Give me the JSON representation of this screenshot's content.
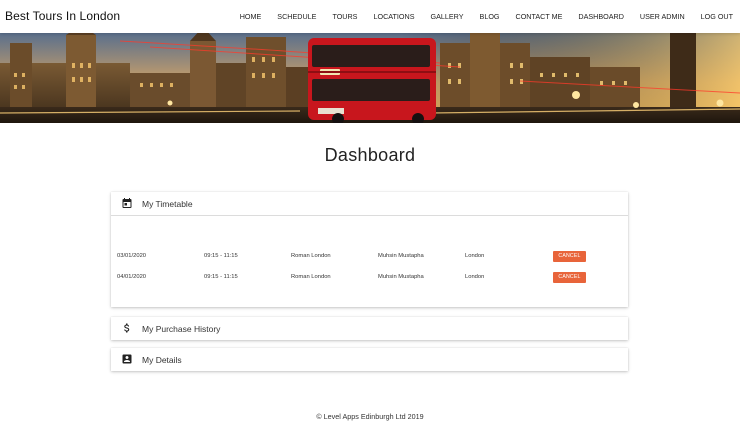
{
  "navbar": {
    "brand": "Best Tours In London",
    "links": [
      "HOME",
      "SCHEDULE",
      "TOURS",
      "LOCATIONS",
      "GALLERY",
      "BLOG",
      "CONTACT ME",
      "DASHBOARD",
      "USER ADMIN",
      "LOG OUT"
    ]
  },
  "page": {
    "title": "Dashboard"
  },
  "timetable": {
    "title": "My Timetable",
    "icon": "calendar-icon",
    "rows": [
      {
        "date": "03/01/2020",
        "time": "09:15 - 11:15",
        "tour": "Roman London",
        "guide": "Muhsin Mustapha",
        "location": "London",
        "action": "CANCEL"
      },
      {
        "date": "04/01/2020",
        "time": "09:15 - 11:15",
        "tour": "Roman London",
        "guide": "Muhsin Mustapha",
        "location": "London",
        "action": "CANCEL"
      }
    ]
  },
  "purchase_history": {
    "title": "My Purchase History",
    "icon": "dollar-icon"
  },
  "details": {
    "title": "My Details",
    "icon": "contact-card-icon"
  },
  "footer": {
    "text": "© Level Apps Edinburgh Ltd 2019"
  },
  "colors": {
    "accent": "#e8643a",
    "bus_red": "#c8161d"
  }
}
